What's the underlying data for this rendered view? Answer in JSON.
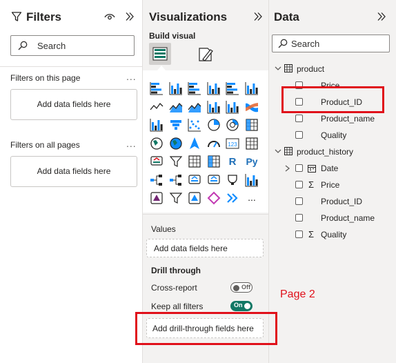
{
  "filters": {
    "title": "Filters",
    "search_placeholder": "Search",
    "on_this_page_label": "Filters on this page",
    "on_all_pages_label": "Filters on all pages",
    "add_fields_label": "Add data fields here",
    "more_options": "..."
  },
  "visualizations": {
    "title": "Visualizations",
    "build_visual_label": "Build visual",
    "values_label": "Values",
    "values_placeholder": "Add data fields here",
    "drill_through_label": "Drill through",
    "cross_report_label": "Cross-report",
    "cross_report_state": "Off",
    "keep_filters_label": "Keep all filters",
    "keep_filters_state": "On",
    "drill_placeholder": "Add drill-through fields here",
    "more_visuals": "...",
    "icons": [
      "stacked-bar-chart-icon",
      "stacked-column-chart-icon",
      "clustered-bar-chart-icon",
      "clustered-column-chart-icon",
      "100-percent-bar-chart-icon",
      "100-percent-column-chart-icon",
      "line-chart-icon",
      "area-chart-icon",
      "stacked-area-chart-icon",
      "line-column-chart-icon",
      "line-clustered-column-chart-icon",
      "ribbon-chart-icon",
      "waterfall-chart-icon",
      "funnel-chart-icon",
      "scatter-chart-icon",
      "pie-chart-icon",
      "donut-chart-icon",
      "treemap-icon",
      "map-icon",
      "filled-map-icon",
      "azure-map-icon",
      "gauge-icon",
      "card-icon",
      "multi-row-card-icon",
      "kpi-icon",
      "slicer-icon",
      "table-icon",
      "matrix-icon",
      "r-visual-icon",
      "python-visual-icon",
      "key-influencers-icon",
      "decomposition-tree-icon",
      "qa-icon",
      "smart-narrative-icon",
      "metrics-icon",
      "paginated-report-icon",
      "power-apps-icon",
      "power-automate-icon",
      "custom-visual-icon",
      "diamond-visual-icon",
      "chevron-visual-icon",
      "more-visuals-icon"
    ],
    "python_label": "Py",
    "r_label": "R",
    "card_label": "123"
  },
  "data": {
    "title": "Data",
    "search_placeholder": "Search",
    "tables": [
      {
        "name": "product",
        "fields": [
          {
            "name": "Price",
            "sigma": false
          },
          {
            "name": "Product_ID",
            "sigma": false
          },
          {
            "name": "Product_name",
            "sigma": false
          },
          {
            "name": "Quality",
            "sigma": false
          }
        ]
      },
      {
        "name": "product_history",
        "fields": [
          {
            "name": "Date",
            "sigma": false
          },
          {
            "name": "Price",
            "sigma": true
          },
          {
            "name": "Product_ID",
            "sigma": false
          },
          {
            "name": "Product_name",
            "sigma": false
          },
          {
            "name": "Quality",
            "sigma": true
          }
        ]
      }
    ]
  },
  "annotation": {
    "page_label": "Page 2",
    "color": "#e0101a"
  },
  "colors": {
    "accent_green": "#117865",
    "pane_gray": "#f3f2f1",
    "icon_blue": "#118dff"
  }
}
